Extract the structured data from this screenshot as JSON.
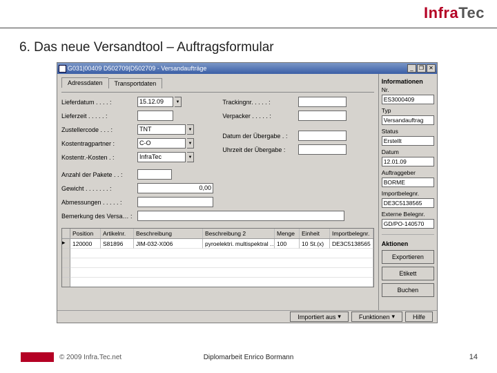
{
  "brand": {
    "part1": "Infra",
    "part2": "Tec"
  },
  "slide_title": "6. Das neue Versandtool – Auftragsformular",
  "window": {
    "title": "G031|00409 D502709|D502709 - Versandaufträge",
    "btn_min": "_",
    "btn_max": "❐",
    "btn_close": "✕",
    "tabs": {
      "t1": "Adressdaten",
      "t2": "Transportdaten"
    },
    "left_fields": {
      "lieferdatum": {
        "label": "Lieferdatum . . . . :",
        "value": "15.12.09",
        "dd": "▼"
      },
      "lieferzeit": {
        "label": "Lieferzeit . . . . . :",
        "value": ""
      },
      "zustellercode": {
        "label": "Zustellercode . . . :",
        "value": "TNT",
        "dd": "▼"
      },
      "kostentragpart": {
        "label": "Kostentragpartner :",
        "value": "C-O",
        "dd": "▼"
      },
      "kostentkosten": {
        "label": "Kostentr.-Kosten . :",
        "value": "InfraTec",
        "dd": "▼"
      }
    },
    "right_fields": {
      "trackingnr": {
        "label": "Trackingnr. . . . . :",
        "value": ""
      },
      "verpacker": {
        "label": "Verpacker . . . . . :",
        "value": ""
      },
      "datum_uebg": {
        "label": "Datum der Übergabe . :",
        "value": ""
      },
      "uhr_uebg": {
        "label": "Uhrzeit der Übergabe :",
        "value": ""
      }
    },
    "mid_fields": {
      "anzpakete": {
        "label": "Anzahl der Pakete . . :",
        "value": ""
      },
      "gewicht": {
        "label": "Gewicht . . . . . . . :",
        "value": "0,00"
      },
      "abmessungen": {
        "label": "Abmessungen . . . . . :",
        "value": ""
      },
      "bemerkung": {
        "label": "Bemerkung des Versa… :",
        "value": ""
      }
    },
    "grid": {
      "headers": {
        "pos": "Position",
        "art": "Artikelnr.",
        "besch": "Beschreibung",
        "besch2": "Beschreibung 2",
        "menge": "Menge",
        "einh": "Einheit",
        "imp": "Importbelegnr."
      },
      "row1": {
        "pos": "120000",
        "art": "S81896",
        "besch": "JIM-032-X006",
        "besch2": "pyroelektri. multispektral …",
        "menge": "100",
        "einh": "10 St.(x)",
        "imp": "DE3C5138565"
      }
    },
    "side": {
      "info_hdr": "Informationen",
      "nr_lbl": "Nr.",
      "nr_val": "ES3000409",
      "typ_lbl": "Typ",
      "typ_val": "Versandauftrag",
      "status_lbl": "Status",
      "status_val": "Erstellt",
      "datum_lbl": "Datum",
      "datum_val": "12.01.09",
      "ag_lbl": "Auftraggeber",
      "ag_val": "BORME",
      "imp_lbl": "Importbelegnr.",
      "imp_val": "DE3C5138565",
      "ext_lbl": "Externe Belegnr.",
      "ext_val": "GD/PO-140570",
      "akt_hdr": "Aktionen",
      "btn_exp": "Exportieren",
      "btn_et": "Etikett",
      "btn_bu": "Buchen"
    },
    "footer": {
      "btn_import": "Importiert aus",
      "btn_funk": "Funktionen",
      "btn_hilfe": "Hilfe",
      "dd": "▾"
    }
  },
  "slide_footer": {
    "copyright": "© 2009 Infra.Tec.net",
    "mid": "Diplomarbeit Enrico Bormann",
    "page": "14"
  }
}
